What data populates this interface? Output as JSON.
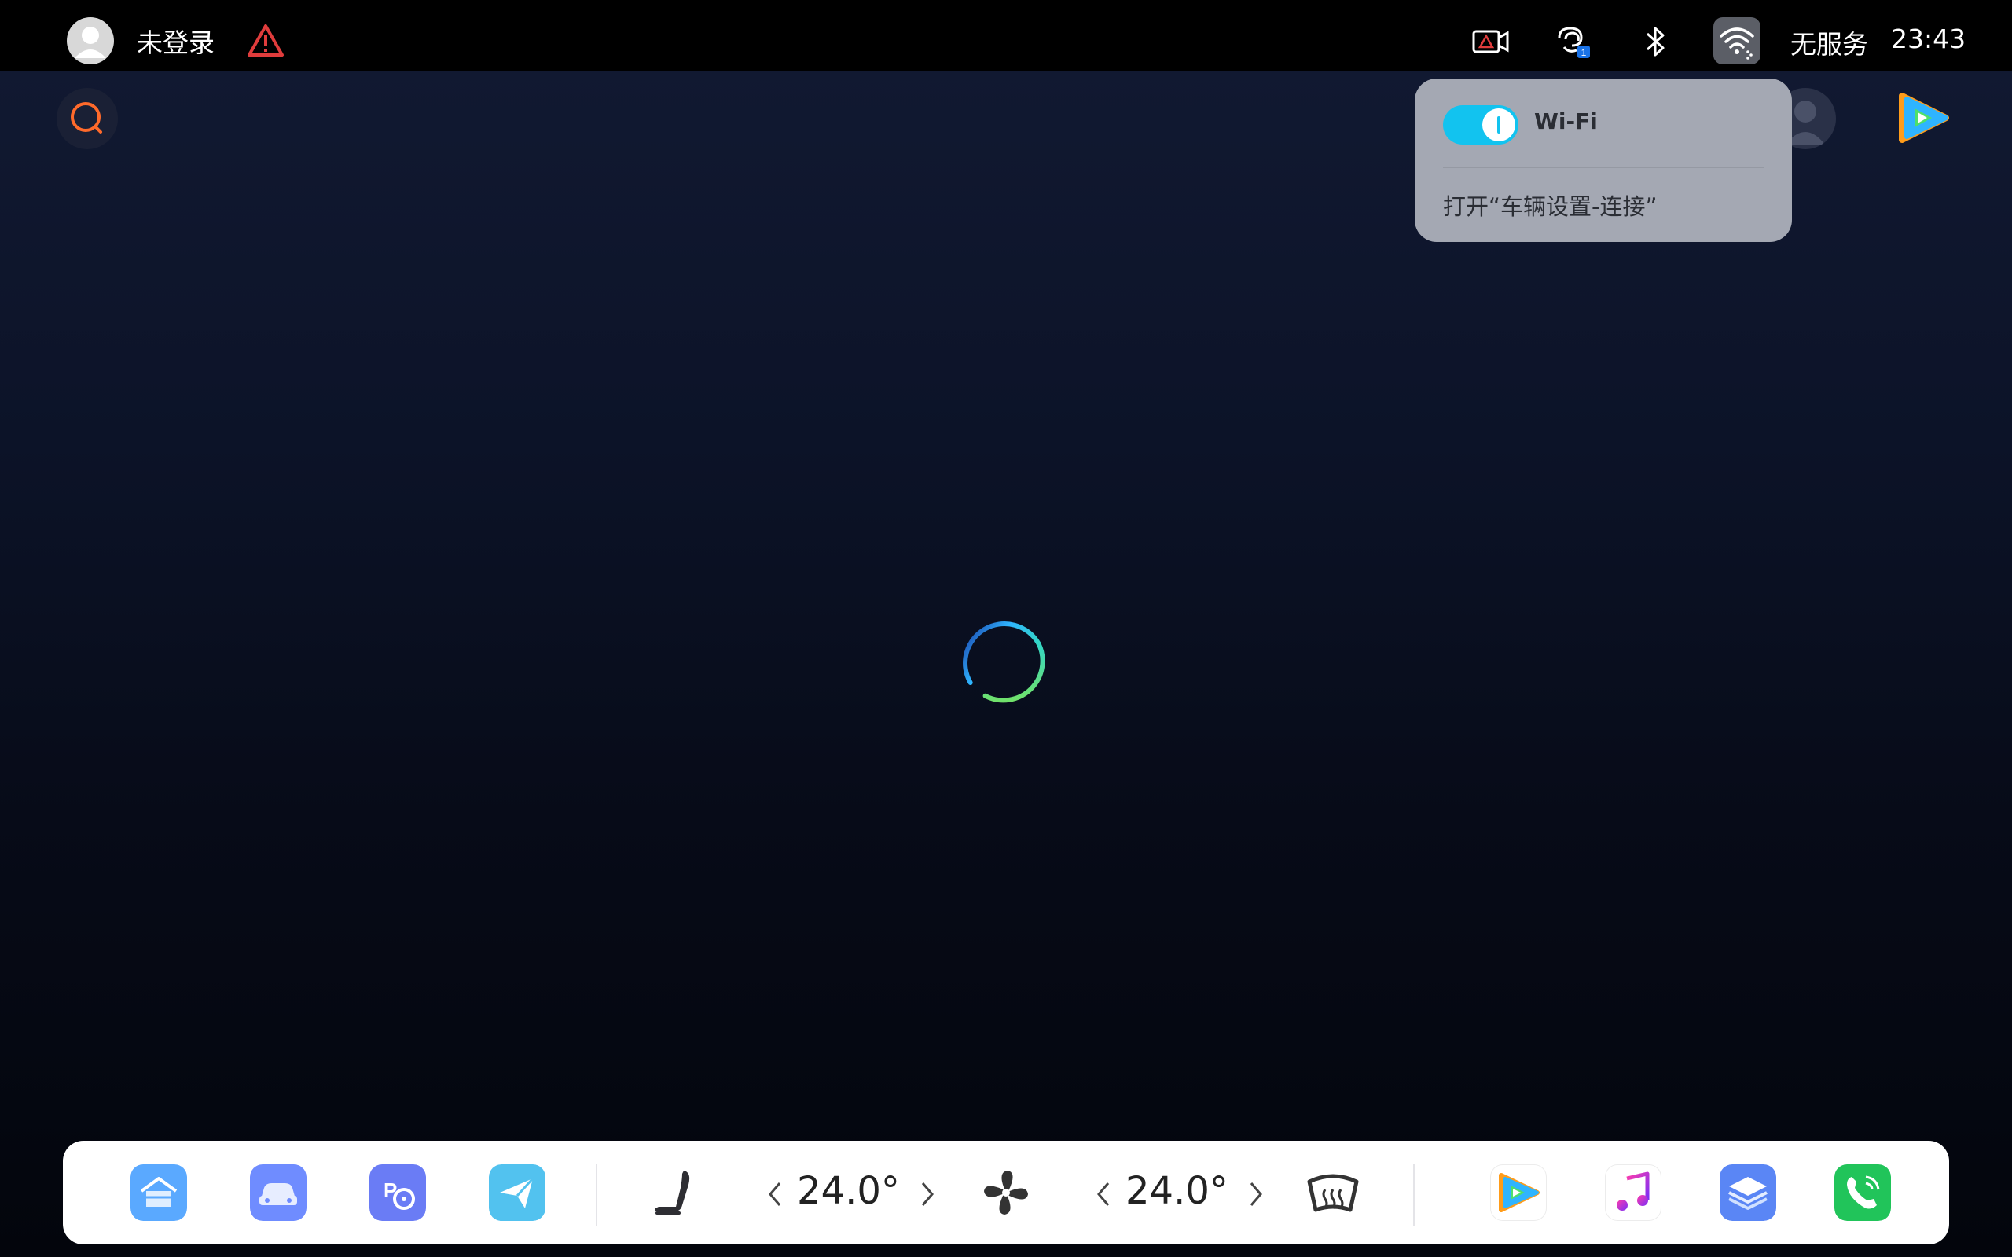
{
  "status_bar": {
    "login_status": "未登录",
    "network_status": "无服务",
    "time": "23:43",
    "connection_badge": "1"
  },
  "wifi_popup": {
    "toggle_label": "Wi-Fi",
    "toggle_on": true,
    "open_settings_link": "打开“车辆设置-连接”"
  },
  "climate": {
    "left_temp": "24.0°",
    "right_temp": "24.0°"
  },
  "dock": {
    "apps_left": [
      "home-app-icon",
      "car-app-icon",
      "parking-app-icon",
      "navigation-app-icon"
    ],
    "apps_right": [
      "video-app-icon",
      "music-app-icon",
      "layers-app-icon",
      "phone-app-icon"
    ]
  },
  "colors": {
    "accent_cyan": "#12c3ef",
    "search_orange": "#ff6a2b",
    "warning_red": "#e03c3c",
    "phone_green": "#21c45a"
  }
}
